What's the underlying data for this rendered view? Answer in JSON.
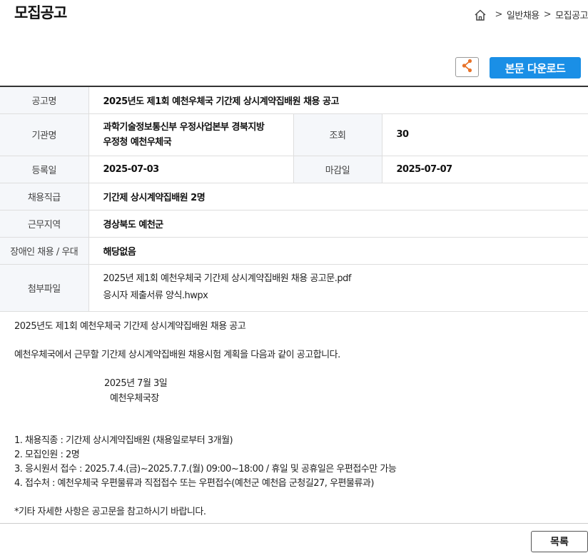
{
  "page": {
    "title": "모집공고"
  },
  "breadcrumb": {
    "home_icon": "home-icon",
    "separator": ">",
    "items": [
      "일반채용",
      "모집공고"
    ]
  },
  "actions": {
    "share_icon": "share-icon",
    "download_label": "본문 다운로드",
    "accent_color": "#1a8fe6",
    "share_icon_color": "#e8732a"
  },
  "info": {
    "announcement_label": "공고명",
    "announcement_value": "2025년도 제1회 예천우체국 기간제 상시계약집배원 채용 공고",
    "agency_label": "기관명",
    "agency_line1": "과학기술정보통신부 우정사업본부 경북지방",
    "agency_line2": "우정청 예천우체국",
    "views_label": "조회",
    "views_value": "30",
    "reg_date_label": "등록일",
    "reg_date_value": "2025-07-03",
    "deadline_label": "마감일",
    "deadline_value": "2025-07-07",
    "job_grade_label": "채용직급",
    "job_grade_value": "기간제 상시계약집배원 2명",
    "work_area_label": "근무지역",
    "work_area_value": "경상북도 예천군",
    "disability_label": "장애인 채용 / 우대",
    "disability_value": "해당없음",
    "attachments_label": "첨부파일",
    "attachments": [
      "2025년 제1회 예천우체국 기간제 상시계약집배원 채용 공고문.pdf",
      "응시자 제출서류 양식.hwpx"
    ]
  },
  "body": {
    "heading": "2025년도 제1회 예천우체국 기간제 상시계약집배원 채용 공고",
    "intro": "예천우체국에서 근무할 기간제 상시계약집배원 채용시험 계획을 다음과 같이 공고합니다.",
    "date": "2025년 7월 3일",
    "signer": "예천우체국장",
    "items": [
      "1. 채용직종 : 기간제 상시계약집배원 (채용일로부터 3개월)",
      "2. 모집인원 : 2명",
      "3. 응시원서 접수 : 2025.7.4.(금)~2025.7.7.(월) 09:00~18:00 / 휴일 및 공휴일은 우편접수만 가능",
      "4. 접수처 : 예천우체국 우편물류과 직접접수 또는 우편접수(예천군 예천읍 군청길27, 우편물류과)"
    ],
    "note": "*기타 자세한 사항은 공고문을 참고하시기 바랍니다."
  },
  "footer": {
    "list_label": "목록"
  }
}
